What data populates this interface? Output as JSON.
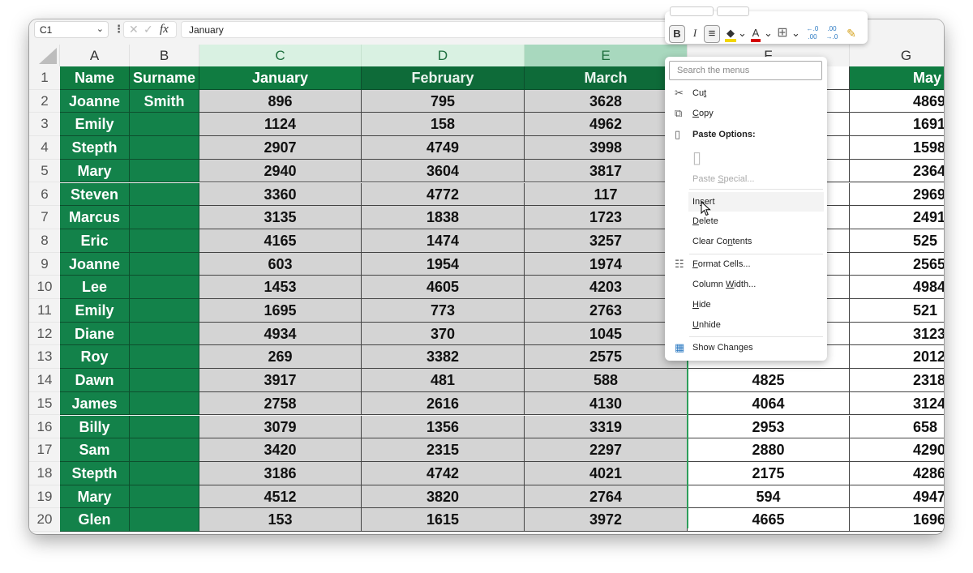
{
  "formula_bar": {
    "name_box": "C1",
    "formula_value": "January",
    "cancel_symbol": "✕",
    "enter_symbol": "✓",
    "fx_label": "fx"
  },
  "columns": [
    "A",
    "B",
    "C",
    "D",
    "E",
    "F",
    "G"
  ],
  "headers": [
    "Name",
    "Surname",
    "January",
    "February",
    "March",
    "",
    "May"
  ],
  "rows": [
    {
      "num": "1"
    },
    {
      "num": "2",
      "name": "Joanne",
      "surname": "Smith",
      "jan": "896",
      "feb": "795",
      "mar": "3628",
      "apr": "",
      "may": "4869"
    },
    {
      "num": "3",
      "name": "Emily",
      "surname": "",
      "jan": "1124",
      "feb": "158",
      "mar": "4962",
      "apr": "",
      "may": "1691"
    },
    {
      "num": "4",
      "name": "Stepth",
      "surname": "",
      "jan": "2907",
      "feb": "4749",
      "mar": "3998",
      "apr": "",
      "may": "1598"
    },
    {
      "num": "5",
      "name": "Mary",
      "surname": "",
      "jan": "2940",
      "feb": "3604",
      "mar": "3817",
      "apr": "",
      "may": "2364"
    },
    {
      "num": "6",
      "name": "Steven",
      "surname": "",
      "jan": "3360",
      "feb": "4772",
      "mar": "117",
      "apr": "",
      "may": "2969"
    },
    {
      "num": "7",
      "name": "Marcus",
      "surname": "",
      "jan": "3135",
      "feb": "1838",
      "mar": "1723",
      "apr": "",
      "may": "2491"
    },
    {
      "num": "8",
      "name": "Eric",
      "surname": "",
      "jan": "4165",
      "feb": "1474",
      "mar": "3257",
      "apr": "",
      "may": "525"
    },
    {
      "num": "9",
      "name": "Joanne",
      "surname": "",
      "jan": "603",
      "feb": "1954",
      "mar": "1974",
      "apr": "",
      "may": "2565"
    },
    {
      "num": "10",
      "name": "Lee",
      "surname": "",
      "jan": "1453",
      "feb": "4605",
      "mar": "4203",
      "apr": "",
      "may": "4984"
    },
    {
      "num": "11",
      "name": "Emily",
      "surname": "",
      "jan": "1695",
      "feb": "773",
      "mar": "2763",
      "apr": "",
      "may": "521"
    },
    {
      "num": "12",
      "name": "Diane",
      "surname": "",
      "jan": "4934",
      "feb": "370",
      "mar": "1045",
      "apr": "",
      "may": "3123"
    },
    {
      "num": "13",
      "name": "Roy",
      "surname": "",
      "jan": "269",
      "feb": "3382",
      "mar": "2575",
      "apr": "",
      "may": "2012"
    },
    {
      "num": "14",
      "name": "Dawn",
      "surname": "",
      "jan": "3917",
      "feb": "481",
      "mar": "588",
      "apr": "4825",
      "may": "2318"
    },
    {
      "num": "15",
      "name": "James",
      "surname": "",
      "jan": "2758",
      "feb": "2616",
      "mar": "4130",
      "apr": "4064",
      "may": "3124"
    },
    {
      "num": "16",
      "name": "Billy",
      "surname": "",
      "jan": "3079",
      "feb": "1356",
      "mar": "3319",
      "apr": "2953",
      "may": "658"
    },
    {
      "num": "17",
      "name": "Sam",
      "surname": "",
      "jan": "3420",
      "feb": "2315",
      "mar": "2297",
      "apr": "2880",
      "may": "4290"
    },
    {
      "num": "18",
      "name": "Stepth",
      "surname": "",
      "jan": "3186",
      "feb": "4742",
      "mar": "4021",
      "apr": "2175",
      "may": "4286"
    },
    {
      "num": "19",
      "name": "Mary",
      "surname": "",
      "jan": "4512",
      "feb": "3820",
      "mar": "2764",
      "apr": "594",
      "may": "4947"
    },
    {
      "num": "20",
      "name": "Glen",
      "surname": "",
      "jan": "153",
      "feb": "1615",
      "mar": "3972",
      "apr": "4665",
      "may": "1696"
    }
  ],
  "mini_toolbar": {
    "bold": "B",
    "italic": "I",
    "fill_color": "#f2d600",
    "font_color": "#d40000",
    "increase_decimal": "←.0 .00",
    "decrease_decimal": ".00 →.0"
  },
  "context_menu": {
    "search_placeholder": "Search the menus",
    "items": [
      {
        "label_pre": "Cu",
        "label_u": "t",
        "label_post": "",
        "icon": "scissors-icon"
      },
      {
        "label_pre": "",
        "label_u": "C",
        "label_post": "opy",
        "icon": "copy-icon"
      },
      {
        "label": "Paste Options:",
        "icon": "clipboard-icon"
      },
      {
        "label_pre": "Paste ",
        "label_u": "S",
        "label_post": "pecial...",
        "disabled": true
      },
      {
        "label_pre": "In",
        "label_u": "s",
        "label_post": "ert",
        "hover": true
      },
      {
        "label_pre": "",
        "label_u": "D",
        "label_post": "elete"
      },
      {
        "label_pre": "Clear Co",
        "label_u": "n",
        "label_post": "tents"
      },
      {
        "label_pre": "",
        "label_u": "F",
        "label_post": "ormat Cells...",
        "icon": "format-cells-icon"
      },
      {
        "label_pre": "Column ",
        "label_u": "W",
        "label_post": "idth..."
      },
      {
        "label_pre": "",
        "label_u": "H",
        "label_post": "ide"
      },
      {
        "label_pre": "",
        "label_u": "U",
        "label_post": "nhide"
      },
      {
        "label": "Show Changes",
        "icon": "show-changes-icon"
      }
    ]
  },
  "colors": {
    "header_green": "#107c41",
    "name_green": "#13824a",
    "selected_gray": "#d4d4d4",
    "selected_col_header": "#d9f1e2"
  }
}
